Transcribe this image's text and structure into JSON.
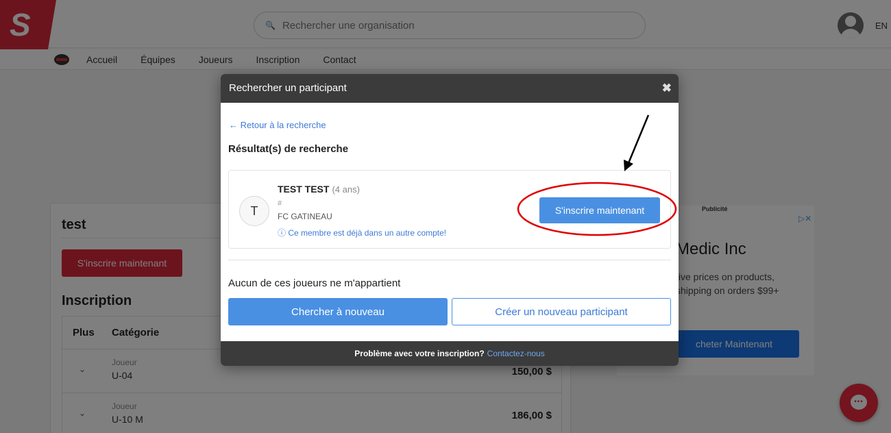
{
  "header": {
    "search_placeholder": "Rechercher une organisation",
    "lang": "EN"
  },
  "nav": {
    "items": [
      "Accueil",
      "Équipes",
      "Joueurs",
      "Inscription",
      "Contact"
    ]
  },
  "left_card": {
    "title": "test",
    "register_label": "S'inscrire maintenant",
    "section_title": "Inscription",
    "table": {
      "col_plus": "Plus",
      "col_category": "Catégorie",
      "rows": [
        {
          "kind": "Joueur",
          "category": "U-04",
          "price": "150,00 $"
        },
        {
          "kind": "Joueur",
          "category": "U-10 M",
          "price": "186,00 $"
        }
      ]
    }
  },
  "ad": {
    "label": "Publicité",
    "title": "Medic Inc",
    "desc_line1": "tive prices on products,",
    "desc_line2": "shipping on orders $99+",
    "cta": "cheter Maintenant"
  },
  "modal": {
    "title": "Rechercher un participant",
    "close_glyph": "✖",
    "back_label": "← Retour à la recherche",
    "results_title": "Résultat(s) de recherche",
    "participant": {
      "initial": "T",
      "name": "TEST TEST",
      "age": "(4 ans)",
      "hash": "#",
      "org": "FC GATINEAU",
      "warning": "ⓘ Ce membre est déjà dans un autre compte!",
      "register_label": "S'inscrire maintenant"
    },
    "none_text": "Aucun de ces joueurs ne m'appartient",
    "search_again_label": "Chercher à nouveau",
    "new_participant_label": "Créer un nouveau participant",
    "footer_text": "Problème avec votre inscription?",
    "footer_link": "Contactez-nous"
  },
  "colors": {
    "brand_red": "#d9283a",
    "primary_blue": "#4a90e2",
    "modal_header": "#3b3b3b",
    "annotation_red": "#e00000"
  }
}
